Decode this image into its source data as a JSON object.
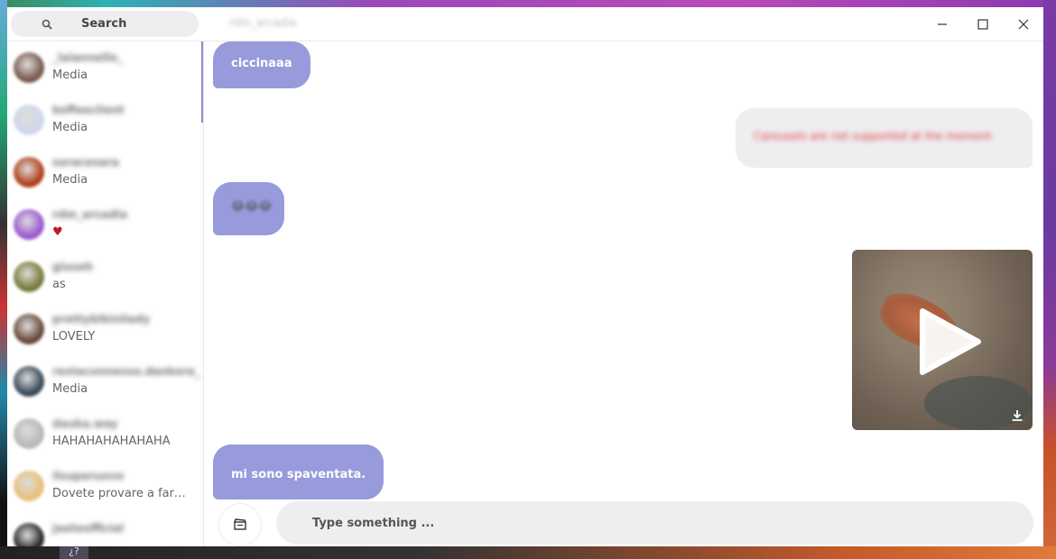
{
  "taskbar": {
    "glyph": "¿?"
  },
  "search": {
    "label": "Search"
  },
  "window": {
    "title": "rdm_arcadia"
  },
  "conversations": [
    {
      "name": "_laiannello_",
      "preview": "Media",
      "avatar_color": "#7a5a4e"
    },
    {
      "name": "koffeeclient",
      "preview": "Media",
      "avatar_color": "#cfd8ea"
    },
    {
      "name": "soracesara",
      "preview": "Media",
      "avatar_color": "#b2401c"
    },
    {
      "name": "rdm_arcadia",
      "preview": "♥",
      "avatar_color": "#9a5ad0"
    },
    {
      "name": "giuseh",
      "preview": "as",
      "avatar_color": "#7a7a3a"
    },
    {
      "name": "prettybikinilady",
      "preview": "LOVELY",
      "avatar_color": "#6a4a3a"
    },
    {
      "name": "restaconnesso.dankore_",
      "preview": "Media",
      "avatar_color": "#3a4a5a"
    },
    {
      "name": "dauka.way",
      "preview": "HAHAHAHAHAHAHA",
      "avatar_color": "#b8b8b8"
    },
    {
      "name": "ilsuperuovo",
      "preview": "Dovete provare a fare un...",
      "avatar_color": "#e8c07a"
    },
    {
      "name": "jaeteofficial",
      "preview": "",
      "avatar_color": "#2a2a2a"
    }
  ],
  "messages": {
    "m1": "ciccinaaa",
    "m2": "Carousels are not supported at the moment",
    "m3": "😂😂😂",
    "m5": "mi sono spaventata."
  },
  "composer": {
    "placeholder": "Type something ..."
  },
  "colors": {
    "incoming": "#979bdc",
    "outgoing": "#eeeef1",
    "accent": "#8c8fc8"
  }
}
